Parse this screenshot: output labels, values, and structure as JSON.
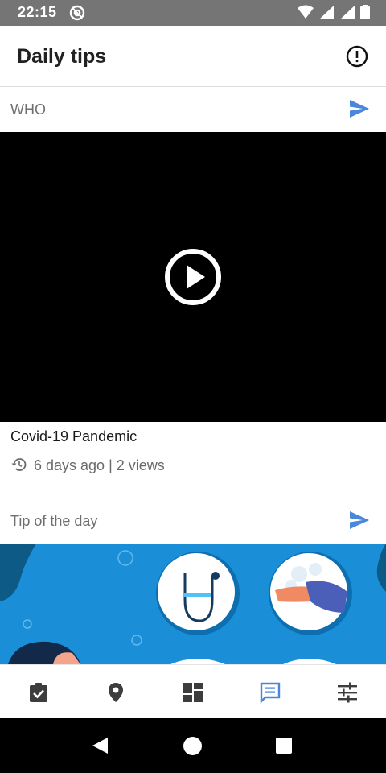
{
  "status_bar": {
    "time": "22:15"
  },
  "app_bar": {
    "title": "Daily tips"
  },
  "sections": [
    {
      "label": "WHO"
    },
    {
      "label": "Tip of the day"
    }
  ],
  "video": {
    "title": "Covid-19 Pandemic",
    "meta": "6 days ago | 2 views"
  },
  "bottom_nav": {
    "items": [
      "checklist-icon",
      "location-icon",
      "dashboard-icon",
      "chat-icon",
      "settings-sliders-icon"
    ],
    "active_index": 3
  },
  "colors": {
    "accent": "#4a86d9",
    "status_bar": "#757575",
    "tip_background": "#1a8fd8"
  }
}
